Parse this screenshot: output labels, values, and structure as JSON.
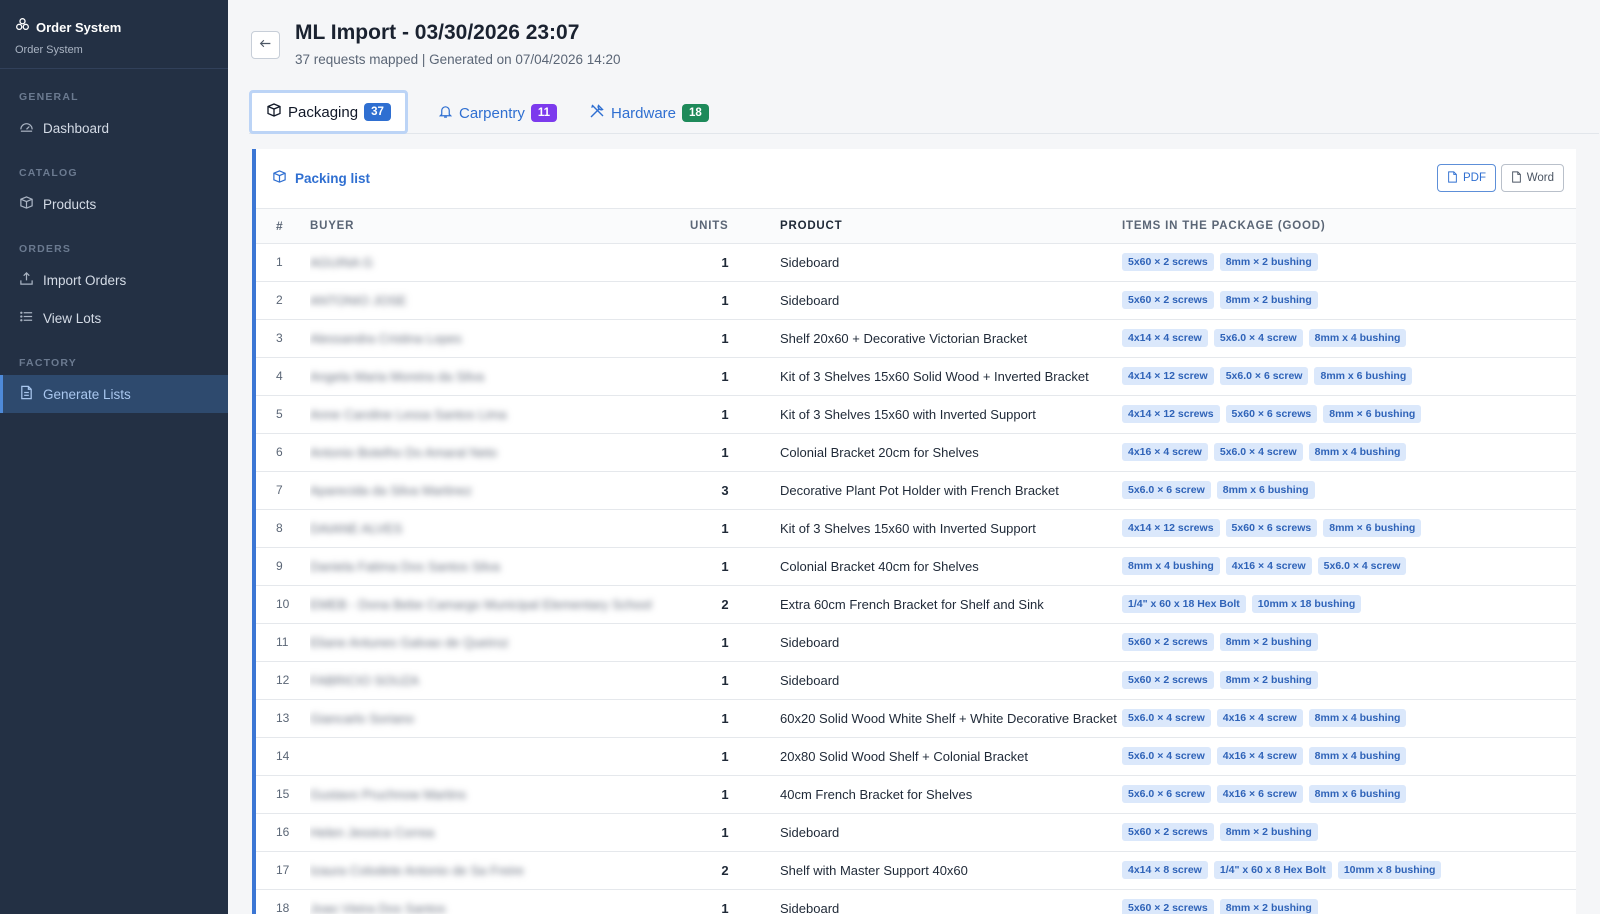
{
  "sidebar": {
    "brand_title": "Order System",
    "brand_sub": "Order System",
    "sections": [
      {
        "label": "GENERAL",
        "items": [
          {
            "label": "Dashboard",
            "icon": "gauge-icon"
          }
        ]
      },
      {
        "label": "CATALOG",
        "items": [
          {
            "label": "Products",
            "icon": "box-icon"
          }
        ]
      },
      {
        "label": "ORDERS",
        "items": [
          {
            "label": "Import Orders",
            "icon": "upload-icon"
          },
          {
            "label": "View Lots",
            "icon": "list-icon"
          }
        ]
      },
      {
        "label": "FACTORY",
        "items": [
          {
            "label": "Generate Lists",
            "icon": "document-icon"
          }
        ]
      }
    ],
    "active_item": "Generate Lists"
  },
  "header": {
    "title": "ML Import - 03/30/2026 23:07",
    "subtitle": "37 requests mapped | Generated on 07/04/2026 14:20"
  },
  "tabs": [
    {
      "label": "Packaging",
      "count": "37",
      "color": "#2f6fd1"
    },
    {
      "label": "Carpentry",
      "count": "11",
      "color": "#7c3aed"
    },
    {
      "label": "Hardware",
      "count": "18",
      "color": "#1e8a5a"
    }
  ],
  "card": {
    "title": "Packing list",
    "pdf_label": "PDF",
    "word_label": "Word"
  },
  "table": {
    "headers": [
      "#",
      "BUYER",
      "UNITS",
      "PRODUCT",
      "ITEMS IN THE PACKAGE (GOOD)"
    ],
    "rows": [
      {
        "n": "1",
        "buyer": "AGUINA G",
        "units": "1",
        "product": "Sideboard",
        "items": [
          "5x60 × 2 screws",
          "8mm × 2 bushing"
        ]
      },
      {
        "n": "2",
        "buyer": "ANTONIO JOSE",
        "units": "1",
        "product": "Sideboard",
        "items": [
          "5x60 × 2 screws",
          "8mm × 2 bushing"
        ]
      },
      {
        "n": "3",
        "buyer": "Alessandra Cristina Lopes",
        "units": "1",
        "product": "Shelf 20x60 + Decorative Victorian Bracket",
        "items": [
          "4x14 × 4 screw",
          "5x6.0 × 4 screw",
          "8mm x 4 bushing"
        ]
      },
      {
        "n": "4",
        "buyer": "Angela Maria Moreira da Silva",
        "units": "1",
        "product": "Kit of 3 Shelves 15x60 Solid Wood + Inverted Bracket",
        "items": [
          "4x14 × 12 screw",
          "5x6.0 × 6 screw",
          "8mm x 6 bushing"
        ]
      },
      {
        "n": "5",
        "buyer": "Anne Caroline Lessa Santos Lima",
        "units": "1",
        "product": "Kit of 3 Shelves 15x60 with Inverted Support",
        "items": [
          "4x14 × 12 screws",
          "5x60 × 6 screws",
          "8mm × 6 bushing"
        ]
      },
      {
        "n": "6",
        "buyer": "Antonio Botelho Do Amaral Neto",
        "units": "1",
        "product": "Colonial Bracket 20cm for Shelves",
        "items": [
          "4x16 × 4 screw",
          "5x6.0 × 4 screw",
          "8mm x 4 bushing"
        ]
      },
      {
        "n": "7",
        "buyer": "Aparecida da Silva Martinez",
        "units": "3",
        "product": "Decorative Plant Pot Holder with French Bracket",
        "items": [
          "5x6.0 × 6 screw",
          "8mm x 6 bushing"
        ]
      },
      {
        "n": "8",
        "buyer": "DAIANE ALVES",
        "units": "1",
        "product": "Kit of 3 Shelves 15x60 with Inverted Support",
        "items": [
          "4x14 × 12 screws",
          "5x60 × 6 screws",
          "8mm × 6 bushing"
        ]
      },
      {
        "n": "9",
        "buyer": "Daniela Fatima Dos Santos Silva",
        "units": "1",
        "product": "Colonial Bracket 40cm for Shelves",
        "items": [
          "8mm x 4 bushing",
          "4x16 × 4 screw",
          "5x6.0 × 4 screw"
        ]
      },
      {
        "n": "10",
        "buyer": "EMEB - Dona Bebe Camargo Municipal Elementary School",
        "units": "2",
        "product": "Extra 60cm French Bracket for Shelf and Sink",
        "items": [
          "1/4\" x 60 x 18 Hex Bolt",
          "10mm x 18 bushing"
        ]
      },
      {
        "n": "11",
        "buyer": "Eliane Antunes Galvao de Queiroz",
        "units": "1",
        "product": "Sideboard",
        "items": [
          "5x60 × 2 screws",
          "8mm × 2 bushing"
        ]
      },
      {
        "n": "12",
        "buyer": "FABRICIO SOUZA",
        "units": "1",
        "product": "Sideboard",
        "items": [
          "5x60 × 2 screws",
          "8mm × 2 bushing"
        ]
      },
      {
        "n": "13",
        "buyer": "Giancarlo Soriano",
        "units": "1",
        "product": "60x20 Solid Wood White Shelf + White Decorative Bracket",
        "items": [
          "5x6.0 × 4 screw",
          "4x16 × 4 screw",
          "8mm x 4 bushing"
        ]
      },
      {
        "n": "14",
        "buyer": "",
        "units": "1",
        "product": "20x80 Solid Wood Shelf + Colonial Bracket",
        "items": [
          "5x6.0 × 4 screw",
          "4x16 × 4 screw",
          "8mm x 4 bushing"
        ]
      },
      {
        "n": "15",
        "buyer": "Gustavo Pruchnow Martins",
        "units": "1",
        "product": "40cm French Bracket for Shelves",
        "items": [
          "5x6.0 × 6 screw",
          "4x16 × 6 screw",
          "8mm x 6 bushing"
        ]
      },
      {
        "n": "16",
        "buyer": "Helen Jessica Correa",
        "units": "1",
        "product": "Sideboard",
        "items": [
          "5x60 × 2 screws",
          "8mm × 2 bushing"
        ]
      },
      {
        "n": "17",
        "buyer": "Izaura Colodete Antonio de Sa Freire",
        "units": "2",
        "product": "Shelf with Master Support 40x60",
        "items": [
          "4x14 × 8 screw",
          "1/4\" x 60 x 8 Hex Bolt",
          "10mm x 8 bushing"
        ]
      },
      {
        "n": "18",
        "buyer": "Joao Vieira Dos Santos",
        "units": "1",
        "product": "Sideboard",
        "items": [
          "5x60 × 2 screws",
          "8mm × 2 bushing"
        ]
      }
    ]
  }
}
